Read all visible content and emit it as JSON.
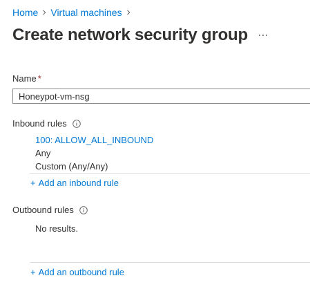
{
  "breadcrumb": {
    "items": [
      "Home",
      "Virtual machines"
    ]
  },
  "page": {
    "title": "Create network security group",
    "more_label": "..."
  },
  "name_field": {
    "label": "Name",
    "required_mark": "*",
    "value": "Honeypot-vm-nsg"
  },
  "inbound": {
    "label": "Inbound rules",
    "rules": [
      {
        "name": "100: ALLOW_ALL_INBOUND",
        "line2": "Any",
        "line3": "Custom (Any/Any)"
      }
    ],
    "add_label": "Add an inbound rule",
    "add_prefix": "+"
  },
  "outbound": {
    "label": "Outbound rules",
    "empty_text": "No results.",
    "add_label": "Add an outbound rule",
    "add_prefix": "+"
  },
  "colors": {
    "link": "#0078d4",
    "text": "#323130",
    "required": "#a4262c",
    "divider": "#e1dfdd"
  },
  "icons": {
    "separator": "chevron-right-icon",
    "info": "info-icon",
    "more": "more-icon"
  }
}
